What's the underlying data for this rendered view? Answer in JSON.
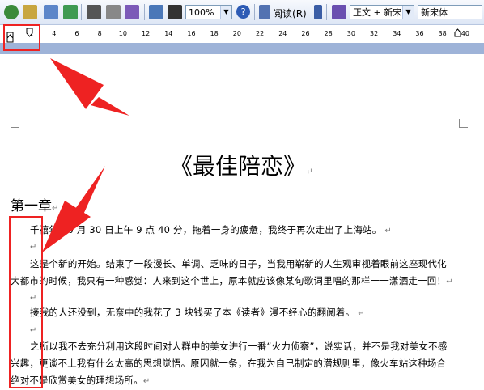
{
  "toolbar": {
    "zoom": "100%",
    "read_label": "阅读",
    "read_shortcut": "(R)",
    "style_value": "正文 + 新宋",
    "font_value": "新宋体",
    "help_label": "?"
  },
  "ruler": {
    "ticks": [
      "2",
      "4",
      "6",
      "8",
      "10",
      "12",
      "14",
      "16",
      "18",
      "20",
      "22",
      "24",
      "26",
      "28",
      "30",
      "32",
      "34",
      "36",
      "38",
      "40"
    ]
  },
  "document": {
    "title": "《最佳陪恋》",
    "chapter": "第一章",
    "paragraph_mark": "↵",
    "lines": [
      "千禧年 10 月 30 日上午 9 点 40 分，拖着一身的疲惫，我终于再次走出了上海站。",
      "这是个新的开始。结束了一段漫长、单调、乏味的日子，当我用崭新的人生观审视着眼前这座现代化",
      "大都市的时候，我只有一种感觉：人来到这个世上，原本就应该像某句歌词里唱的那样一一潇洒走一回！",
      "接我的人还没到，无奈中的我花了 3 块钱买了本《读者》漫不经心的翻阅着。",
      "之所以我不去充分利用这段时间对人群中的美女进行一番“火力侦察”，说实话，并不是我对美女不感",
      "兴趣，更谈不上我有什么太高的思想觉悟。原因就一条，在我为自己制定的潜规则里，像火车站这种场合",
      "绝对不是欣赏美女的理想场所。"
    ]
  },
  "colors": {
    "annotation": "#ee2222",
    "toolbar_bg": "#dde6f5"
  }
}
